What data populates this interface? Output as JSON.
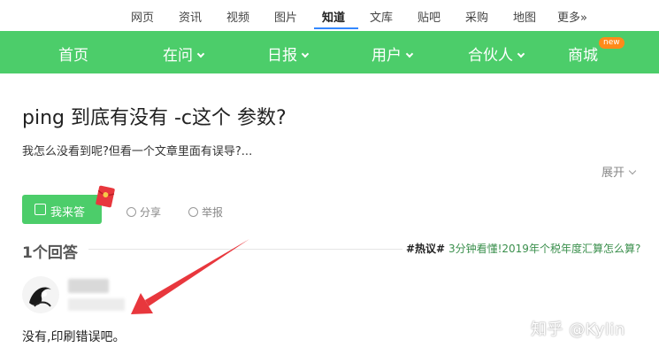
{
  "top_nav": {
    "items": [
      "网页",
      "资讯",
      "视频",
      "图片",
      "知道",
      "文库",
      "贴吧",
      "采购",
      "地图",
      "更多»"
    ],
    "active": "知道"
  },
  "green_nav": {
    "items": [
      "首页",
      "在问",
      "日报",
      "用户",
      "合伙人",
      "商城"
    ],
    "new_badge": "new"
  },
  "question": {
    "title": "ping 到底有没有 -c这个 参数?",
    "description": "我怎么没看到呢?但看一个文章里面有误导?...",
    "expand_label": "展开"
  },
  "actions": {
    "answer_button": "我来答",
    "share": "分享",
    "report": "举报"
  },
  "answers": {
    "count_label": "1个回答",
    "hot_tag": "#热议#",
    "hot_link": "3分钟看懂!2019年个税年度汇算怎么算?",
    "items": [
      {
        "text": "没有,印刷错误吧。"
      }
    ]
  },
  "watermark": "知乎 @Kylin",
  "colors": {
    "brand_green": "#4ccd6a",
    "annotation_arrow": "#e8373d",
    "link_blue": "#3388ff"
  },
  "icons": {
    "answer": "edit-icon",
    "share": "share-icon",
    "report": "report-icon",
    "red_packet": "red-packet-icon"
  }
}
